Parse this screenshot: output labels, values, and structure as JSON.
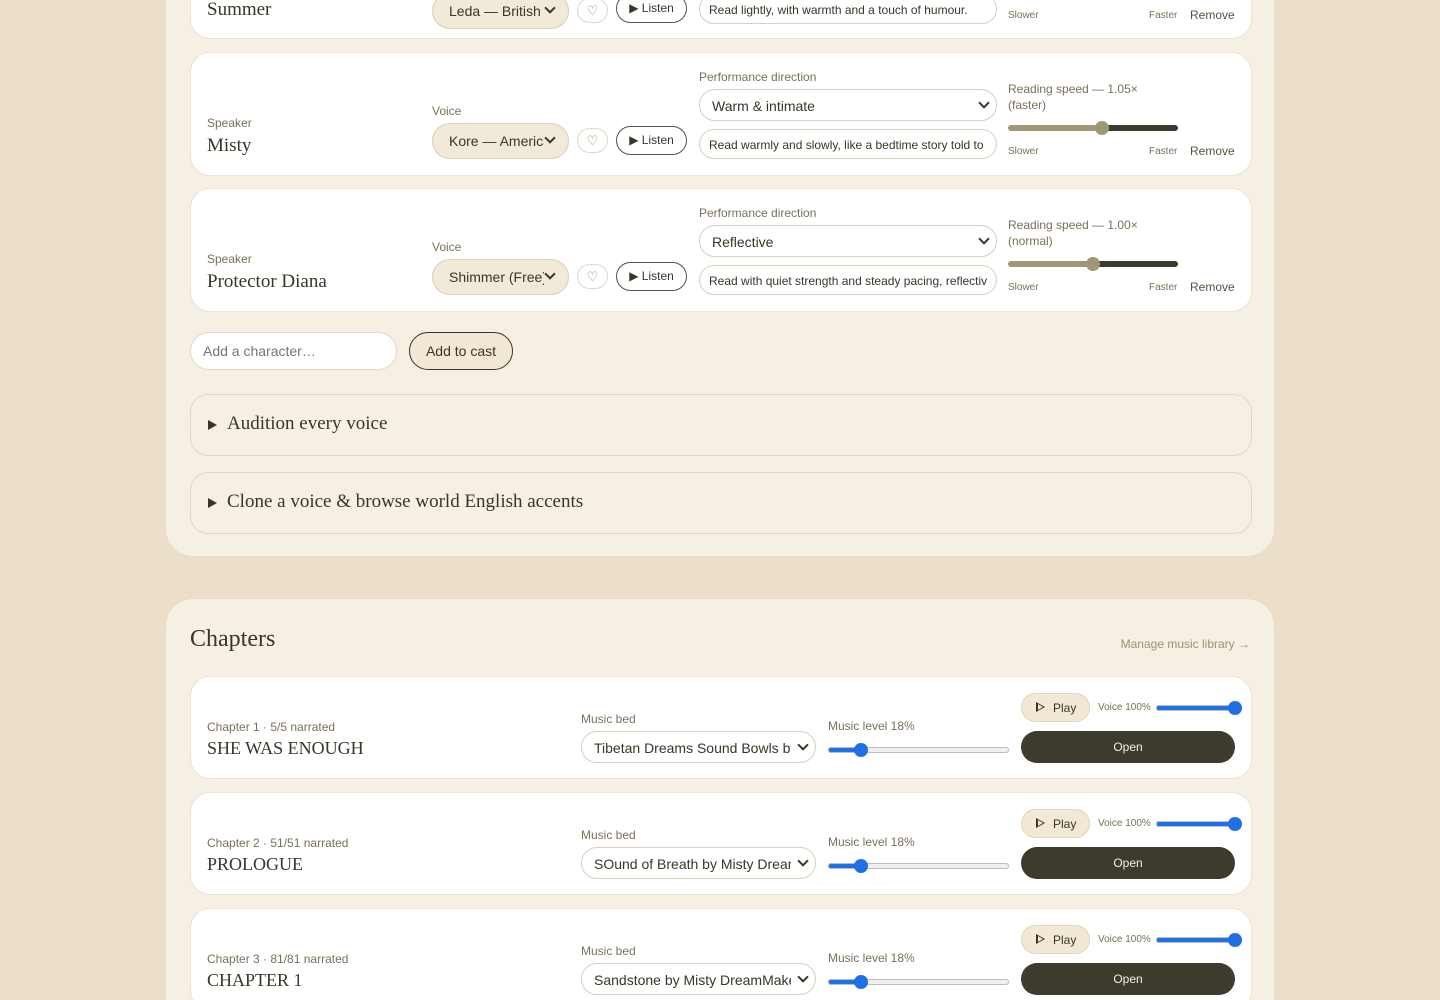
{
  "cast": {
    "labels": {
      "speaker": "Speaker",
      "voice": "Voice",
      "performance_direction": "Performance direction",
      "slower": "Slower",
      "faster": "Faster",
      "remove": "Remove",
      "favorite": "♡",
      "listen": "▶ Listen"
    },
    "speakers": [
      {
        "name": "Summer",
        "voice": "Leda — British",
        "direction_note": "Read lightly, with warmth and a touch of humour."
      },
      {
        "name": "Misty",
        "voice": "Kore — American",
        "direction": "Warm & intimate",
        "direction_note": "Read warmly and slowly, like a bedtime story told to someone you love.",
        "speed_label": "Reading speed — 1.05× (faster)",
        "speed": 1.05
      },
      {
        "name": "Protector Diana",
        "voice": "Shimmer (Free)",
        "direction": "Reflective",
        "direction_note": "Read with quiet strength and steady pacing, reflective and calm.",
        "speed_label": "Reading speed — 1.00× (normal)",
        "speed": 1.0
      }
    ],
    "speed_range": [
      0.5,
      1.5
    ],
    "add_placeholder": "Add a character…",
    "add_button": "Add to cast",
    "audition_title": "Audition every voice",
    "clone_title": "Clone a voice & browse world English accents"
  },
  "chapters": {
    "title": "Chapters",
    "manage_link": "Manage music library →",
    "labels": {
      "music_bed": "Music bed",
      "play": "Play",
      "open": "Open"
    },
    "items": [
      {
        "meta": "Chapter 1 · 5/5 narrated",
        "title": "SHE WAS ENOUGH",
        "music": "Tibetan Dreams Sound Bowls by Misty DreamMaker",
        "music_level_label": "Music level 18%",
        "music_level": 18,
        "voice_label": "Voice 100%",
        "voice_level": 100
      },
      {
        "meta": "Chapter 2 · 51/51 narrated",
        "title": "PROLOGUE",
        "music": "SOund of Breath by Misty DreamMaker",
        "music_level_label": "Music level 18%",
        "music_level": 18,
        "voice_label": "Voice 100%",
        "voice_level": 100
      },
      {
        "meta": "Chapter 3 · 81/81 narrated",
        "title": "CHAPTER 1",
        "music": "Sandstone by Misty DreamMaker",
        "music_level_label": "Music level 18%",
        "music_level": 18,
        "voice_label": "Voice 100%",
        "voice_level": 100
      }
    ]
  },
  "colors": {
    "page_bg": "#ebdfc7",
    "panel_bg": "#f5efe4",
    "ink": "#3a3528",
    "speed_track_filled": "#a09777",
    "speed_track_rest": "#3d3a2e",
    "music_accent": "#1f6fe5",
    "open_button": "#3d3a2e"
  },
  "icons": {
    "favorite": "heart-outline-icon",
    "expand": "triangle-right-icon",
    "chevron": "chevron-down-icon",
    "play": "play-outline-icon"
  }
}
